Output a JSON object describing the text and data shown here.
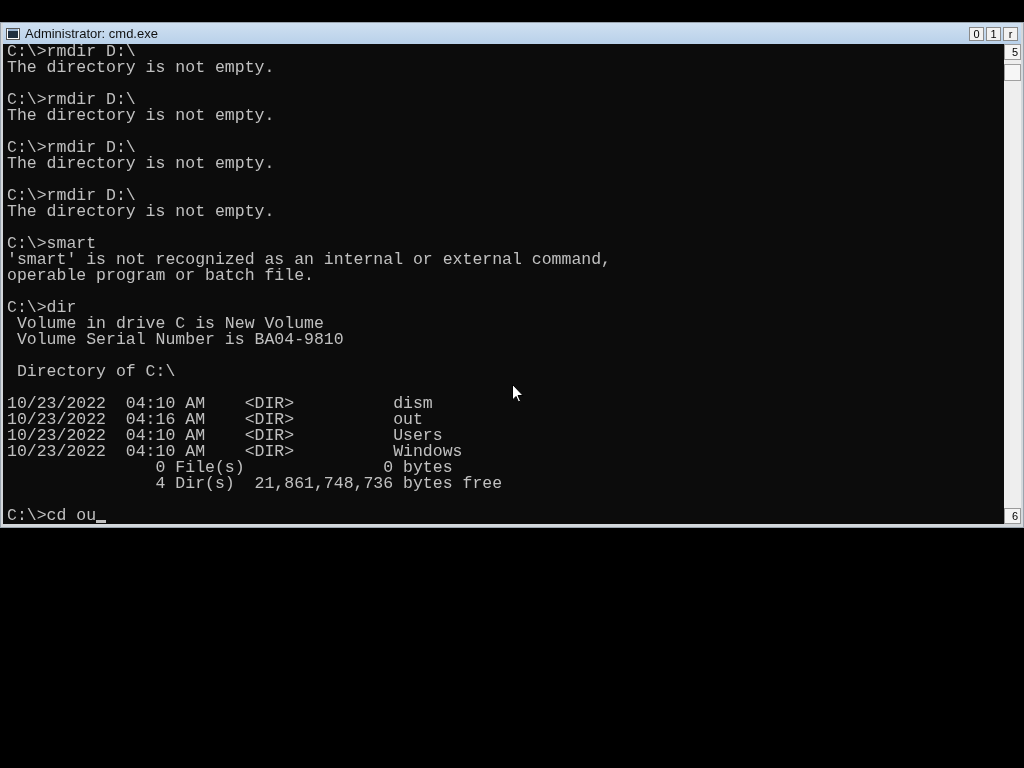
{
  "window": {
    "title": "Administrator: cmd.exe",
    "buttons": [
      "0",
      "1",
      "r"
    ]
  },
  "console": {
    "blocks": [
      [
        "C:\\>rmdir D:\\",
        "The directory is not empty."
      ],
      [
        "C:\\>rmdir D:\\",
        "The directory is not empty."
      ],
      [
        "C:\\>rmdir D:\\",
        "The directory is not empty."
      ],
      [
        "C:\\>rmdir D:\\",
        "The directory is not empty."
      ],
      [
        "C:\\>smart",
        "'smart' is not recognized as an internal or external command,",
        "operable program or batch file."
      ],
      [
        "C:\\>dir",
        " Volume in drive C is New Volume",
        " Volume Serial Number is BA04-9810"
      ],
      [
        " Directory of C:\\"
      ],
      [
        "10/23/2022  04:10 AM    <DIR>          dism",
        "10/23/2022  04:16 AM    <DIR>          out",
        "10/23/2022  04:10 AM    <DIR>          Users",
        "10/23/2022  04:10 AM    <DIR>          Windows",
        "               0 File(s)              0 bytes",
        "               4 Dir(s)  21,861,748,736 bytes free"
      ]
    ],
    "input": {
      "text": "C:\\>cd ou",
      "cursor": true
    }
  },
  "scrollbar": {
    "up": "5",
    "down": "6"
  }
}
